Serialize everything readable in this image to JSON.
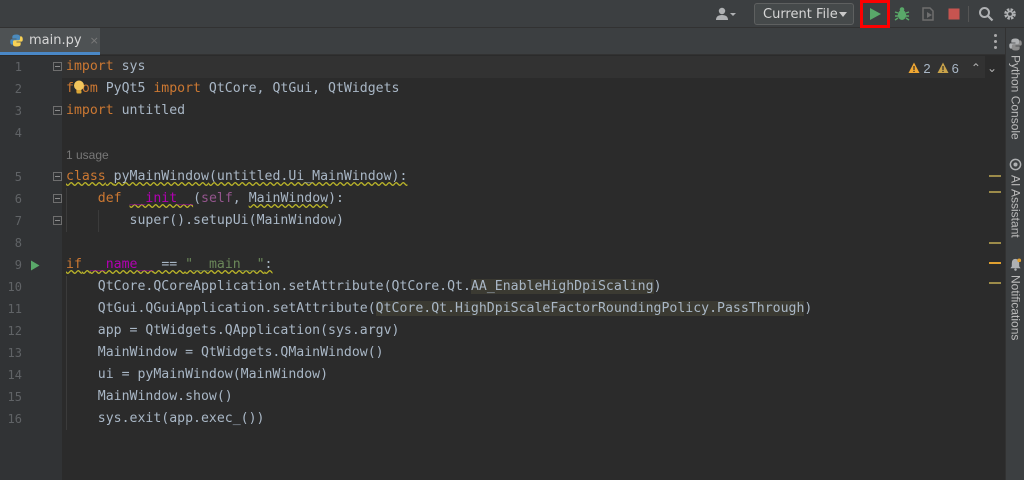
{
  "toolbar": {
    "run_config": "Current File",
    "icons": [
      "profile-icon",
      "run-icon",
      "debug-icon",
      "coverage-icon",
      "stop-icon",
      "search-icon",
      "settings-icon"
    ],
    "run_highlight_color": "#ff0000"
  },
  "tabs": [
    {
      "label": "main.py",
      "close": "×"
    }
  ],
  "inspections": {
    "warnings": "2",
    "weak_warnings": "6",
    "up": "⌃",
    "down": "⌄"
  },
  "line_numbers": [
    "1",
    "2",
    "3",
    "4",
    "5",
    "6",
    "7",
    "8",
    "9",
    "10",
    "11",
    "12",
    "13",
    "14",
    "15",
    "16"
  ],
  "usage_hint": "1 usage",
  "code": {
    "l1": {
      "kw": "import",
      "rest": " sys"
    },
    "l2": {
      "kw1": "from",
      "mid": " PyQt5 ",
      "kw2": "import",
      "rest": " QtCore, QtGui, QtWidgets"
    },
    "l3": {
      "kw": "import",
      "rest": " untitled"
    },
    "l5": {
      "kw": "class",
      "sp": " ",
      "name": "pyMainWindow",
      "rest": "(untitled.Ui_MainWindow):"
    },
    "l6": {
      "indent": "    ",
      "kw": "def",
      "sp": " ",
      "name": "__init__",
      "p1": "(",
      "self": "self",
      "p2": ", ",
      "arg": "MainWindow",
      "p3": "):"
    },
    "l7": {
      "indent": "        ",
      "text": "super().setupUi(MainWindow)"
    },
    "l9": {
      "kw": "if",
      "sp1": " ",
      "name": "__name__",
      "op": " == ",
      "str": "\"__main__\"",
      "end": ":"
    },
    "l10": {
      "indent": "    ",
      "pre": "QtCore.QCoreApplication.setAttribute(QtCore.Qt.",
      "hl": "AA_EnableHighDpiScaling",
      "post": ")"
    },
    "l11": {
      "indent": "    ",
      "pre": "QtGui.QGuiApplication.setAttribute(",
      "hl": "QtCore.Qt.HighDpiScaleFactorRoundingPolicy.PassThrough",
      "post": ")"
    },
    "l12": {
      "indent": "    ",
      "text": "app = QtWidgets.QApplication(sys.argv)"
    },
    "l13": {
      "indent": "    ",
      "text": "MainWindow = QtWidgets.QMainWindow()"
    },
    "l14": {
      "indent": "    ",
      "text": "ui = pyMainWindow(MainWindow)"
    },
    "l15": {
      "indent": "    ",
      "text": "MainWindow.show()"
    },
    "l16": {
      "indent": "    ",
      "text": "sys.exit(app.exec_())"
    }
  },
  "right_tools": [
    {
      "label": "Python Console",
      "icon": "python-console-icon"
    },
    {
      "label": "AI Assistant",
      "icon": "ai-assistant-icon"
    },
    {
      "label": "Notifications",
      "icon": "bell-icon"
    }
  ],
  "colors": {
    "keyword": "#cc7832",
    "function": "#ffc66d",
    "dunder": "#b200b2",
    "string": "#6a8759",
    "run_green": "#59a869",
    "stop_red": "#c75450"
  }
}
